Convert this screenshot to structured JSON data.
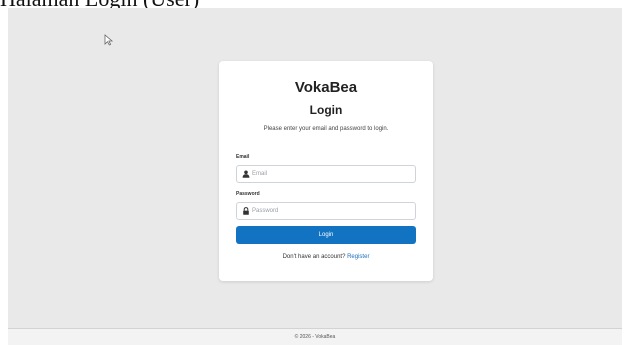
{
  "document": {
    "caption": "Halaman Login (User)"
  },
  "app": {
    "brand": "VokaBea"
  },
  "login": {
    "title": "Login",
    "instructions": "Please enter your email and password to login.",
    "email": {
      "label": "Email",
      "placeholder": "Email",
      "icon": "user-icon"
    },
    "password": {
      "label": "Password",
      "placeholder": "Password",
      "icon": "lock-icon"
    },
    "submit_label": "Login",
    "no_account_text": "Don't have an account?",
    "register_label": "Register"
  },
  "footer": {
    "text": "© 2026 - VokaBea"
  },
  "colors": {
    "accent": "#1273c2",
    "link": "#1a6fbf",
    "background": "#e9e9e9",
    "card": "#ffffff"
  }
}
